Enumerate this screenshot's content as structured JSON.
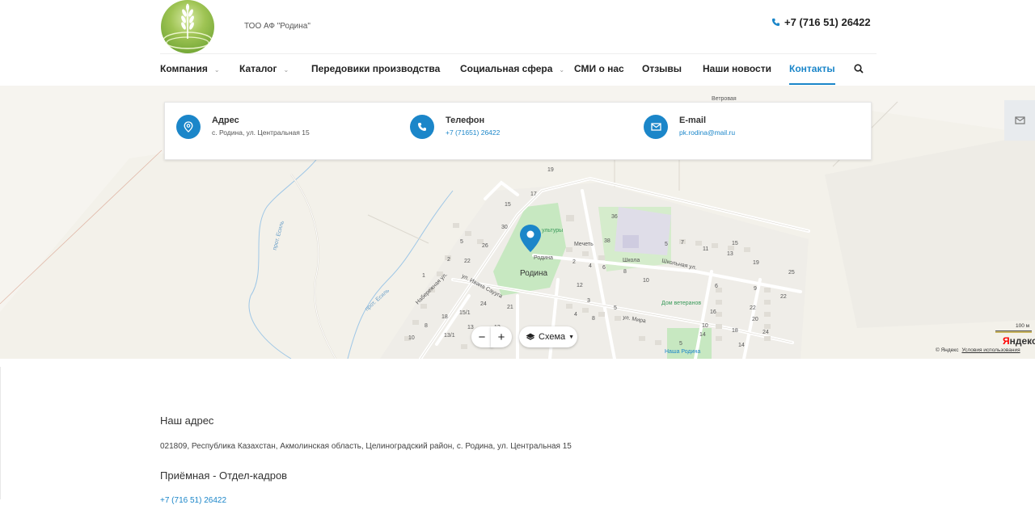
{
  "header": {
    "company_name": "ТОО АФ \"Родина\"",
    "phone": "+7 (716 51) 26422"
  },
  "nav": {
    "items": [
      {
        "label": "Компания",
        "dropdown": true
      },
      {
        "label": "Каталог",
        "dropdown": true
      },
      {
        "label": "Передовики производства",
        "dropdown": false
      },
      {
        "label": "Социальная сфера",
        "dropdown": true
      },
      {
        "label": "СМИ о нас",
        "dropdown": false
      },
      {
        "label": "Отзывы",
        "dropdown": false
      },
      {
        "label": "Наши новости",
        "dropdown": false
      },
      {
        "label": "Контакты",
        "dropdown": false,
        "active": true
      }
    ]
  },
  "contacts_card": {
    "address_title": "Адрес",
    "address_value": "с. Родина, ул. Центральная 15",
    "phone_title": "Телефон",
    "phone_value": "+7 (71651) 26422",
    "email_title": "E-mail",
    "email_value": "pk.rodina@mail.ru"
  },
  "map": {
    "labels": {
      "vetrovaya": "Ветровая",
      "mechet": "Мечеть",
      "shkola": "Школа",
      "rodina_poi": "Родина",
      "rodina_town": "Родина",
      "kultury": "ультуры",
      "dom_veteranov": "Дом ветеранов",
      "nasha_rodina": "Наша Родина",
      "street_shkolnaya": "Школьная ул.",
      "street_mira": "ул. Мира",
      "street_ivana": "ул. Ивана Саууга",
      "street_naberezhnaya": "Набережная ул.",
      "channel_esil_1": "прот. Есиль",
      "channel_esil_2": "прот. Есиль"
    },
    "house_numbers": [
      "19",
      "17",
      "15",
      "30",
      "26",
      "5",
      "22",
      "36",
      "38",
      "5",
      "7",
      "11",
      "13",
      "15",
      "19",
      "25",
      "2",
      "4",
      "6",
      "8",
      "10",
      "12",
      "3",
      "5",
      "9",
      "22",
      "20",
      "21",
      "24",
      "10",
      "14",
      "16",
      "18",
      "24",
      "4",
      "8",
      "18",
      "15/1",
      "13/1",
      "10",
      "8",
      "12",
      "13",
      "14",
      "22",
      "2",
      "1",
      "5",
      "6"
    ],
    "zoom_out": "−",
    "zoom_in": "+",
    "scheme_label": "Схема",
    "scale_label": "100 м",
    "brand": "Яндекс",
    "copyright": "© Яндекс",
    "terms_link": "Условия использования"
  },
  "content": {
    "address_heading": "Наш адрес",
    "address_full": "021809, Республика Казахстан, Акмолинская область, Целиноградский район, с. Родина, ул. Центральная 15",
    "reception_heading": "Приёмная - Отдел-кадров",
    "reception_phone": "+7 (716 51) 26422"
  }
}
